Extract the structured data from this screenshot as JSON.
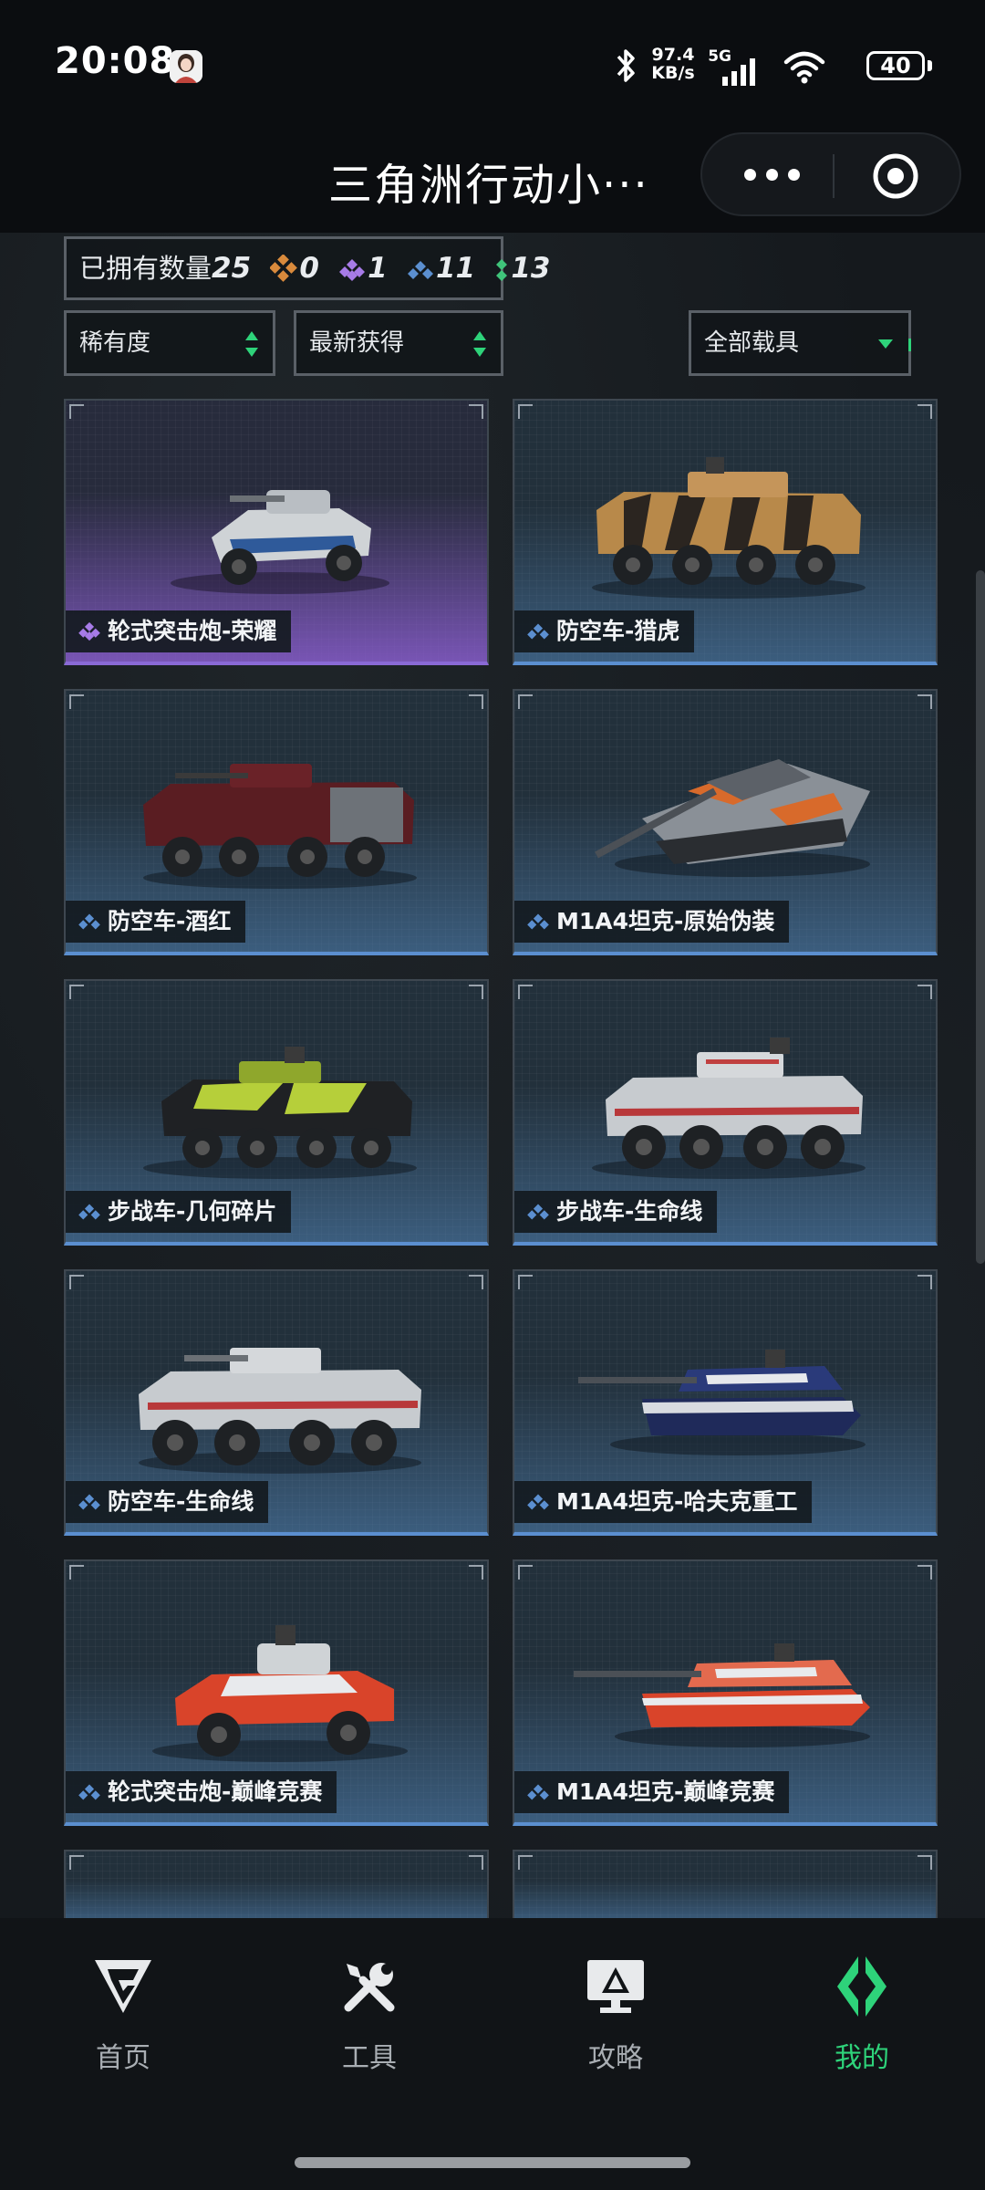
{
  "status_bar": {
    "time": "20:08",
    "net_speed_value": "97.4",
    "net_speed_unit": "KB/s",
    "network": "5G",
    "battery": "40"
  },
  "header": {
    "title": "三角洲行动小···"
  },
  "summary": {
    "owned_label": "已拥有数量",
    "owned_count": "25",
    "gold_count": "0",
    "purple_count": "1",
    "blue_count": "11",
    "green_count": "13"
  },
  "filters": {
    "rarity": "稀有度",
    "sort": "最新获得",
    "vehicle_type": "全部载具"
  },
  "vehicles": [
    {
      "name": "轮式突击炮-荣耀",
      "rarity": "purple"
    },
    {
      "name": "防空车-猎虎",
      "rarity": "blue"
    },
    {
      "name": "防空车-酒红",
      "rarity": "blue"
    },
    {
      "name": "M1A4坦克-原始伪装",
      "rarity": "blue"
    },
    {
      "name": "步战车-几何碎片",
      "rarity": "blue"
    },
    {
      "name": "步战车-生命线",
      "rarity": "blue"
    },
    {
      "name": "防空车-生命线",
      "rarity": "blue"
    },
    {
      "name": "M1A4坦克-哈夫克重工",
      "rarity": "blue"
    },
    {
      "name": "轮式突击炮-巅峰竞赛",
      "rarity": "blue"
    },
    {
      "name": "M1A4坦克-巅峰竞赛",
      "rarity": "blue"
    }
  ],
  "nav": {
    "home": "首页",
    "tools": "工具",
    "guide": "攻略",
    "mine": "我的"
  },
  "colors": {
    "accent_green": "#2ed37a",
    "rarity_gold": "#d98a3c",
    "rarity_purple": "#a77be8",
    "rarity_blue": "#5b8fd0",
    "rarity_green": "#3fc47a"
  }
}
